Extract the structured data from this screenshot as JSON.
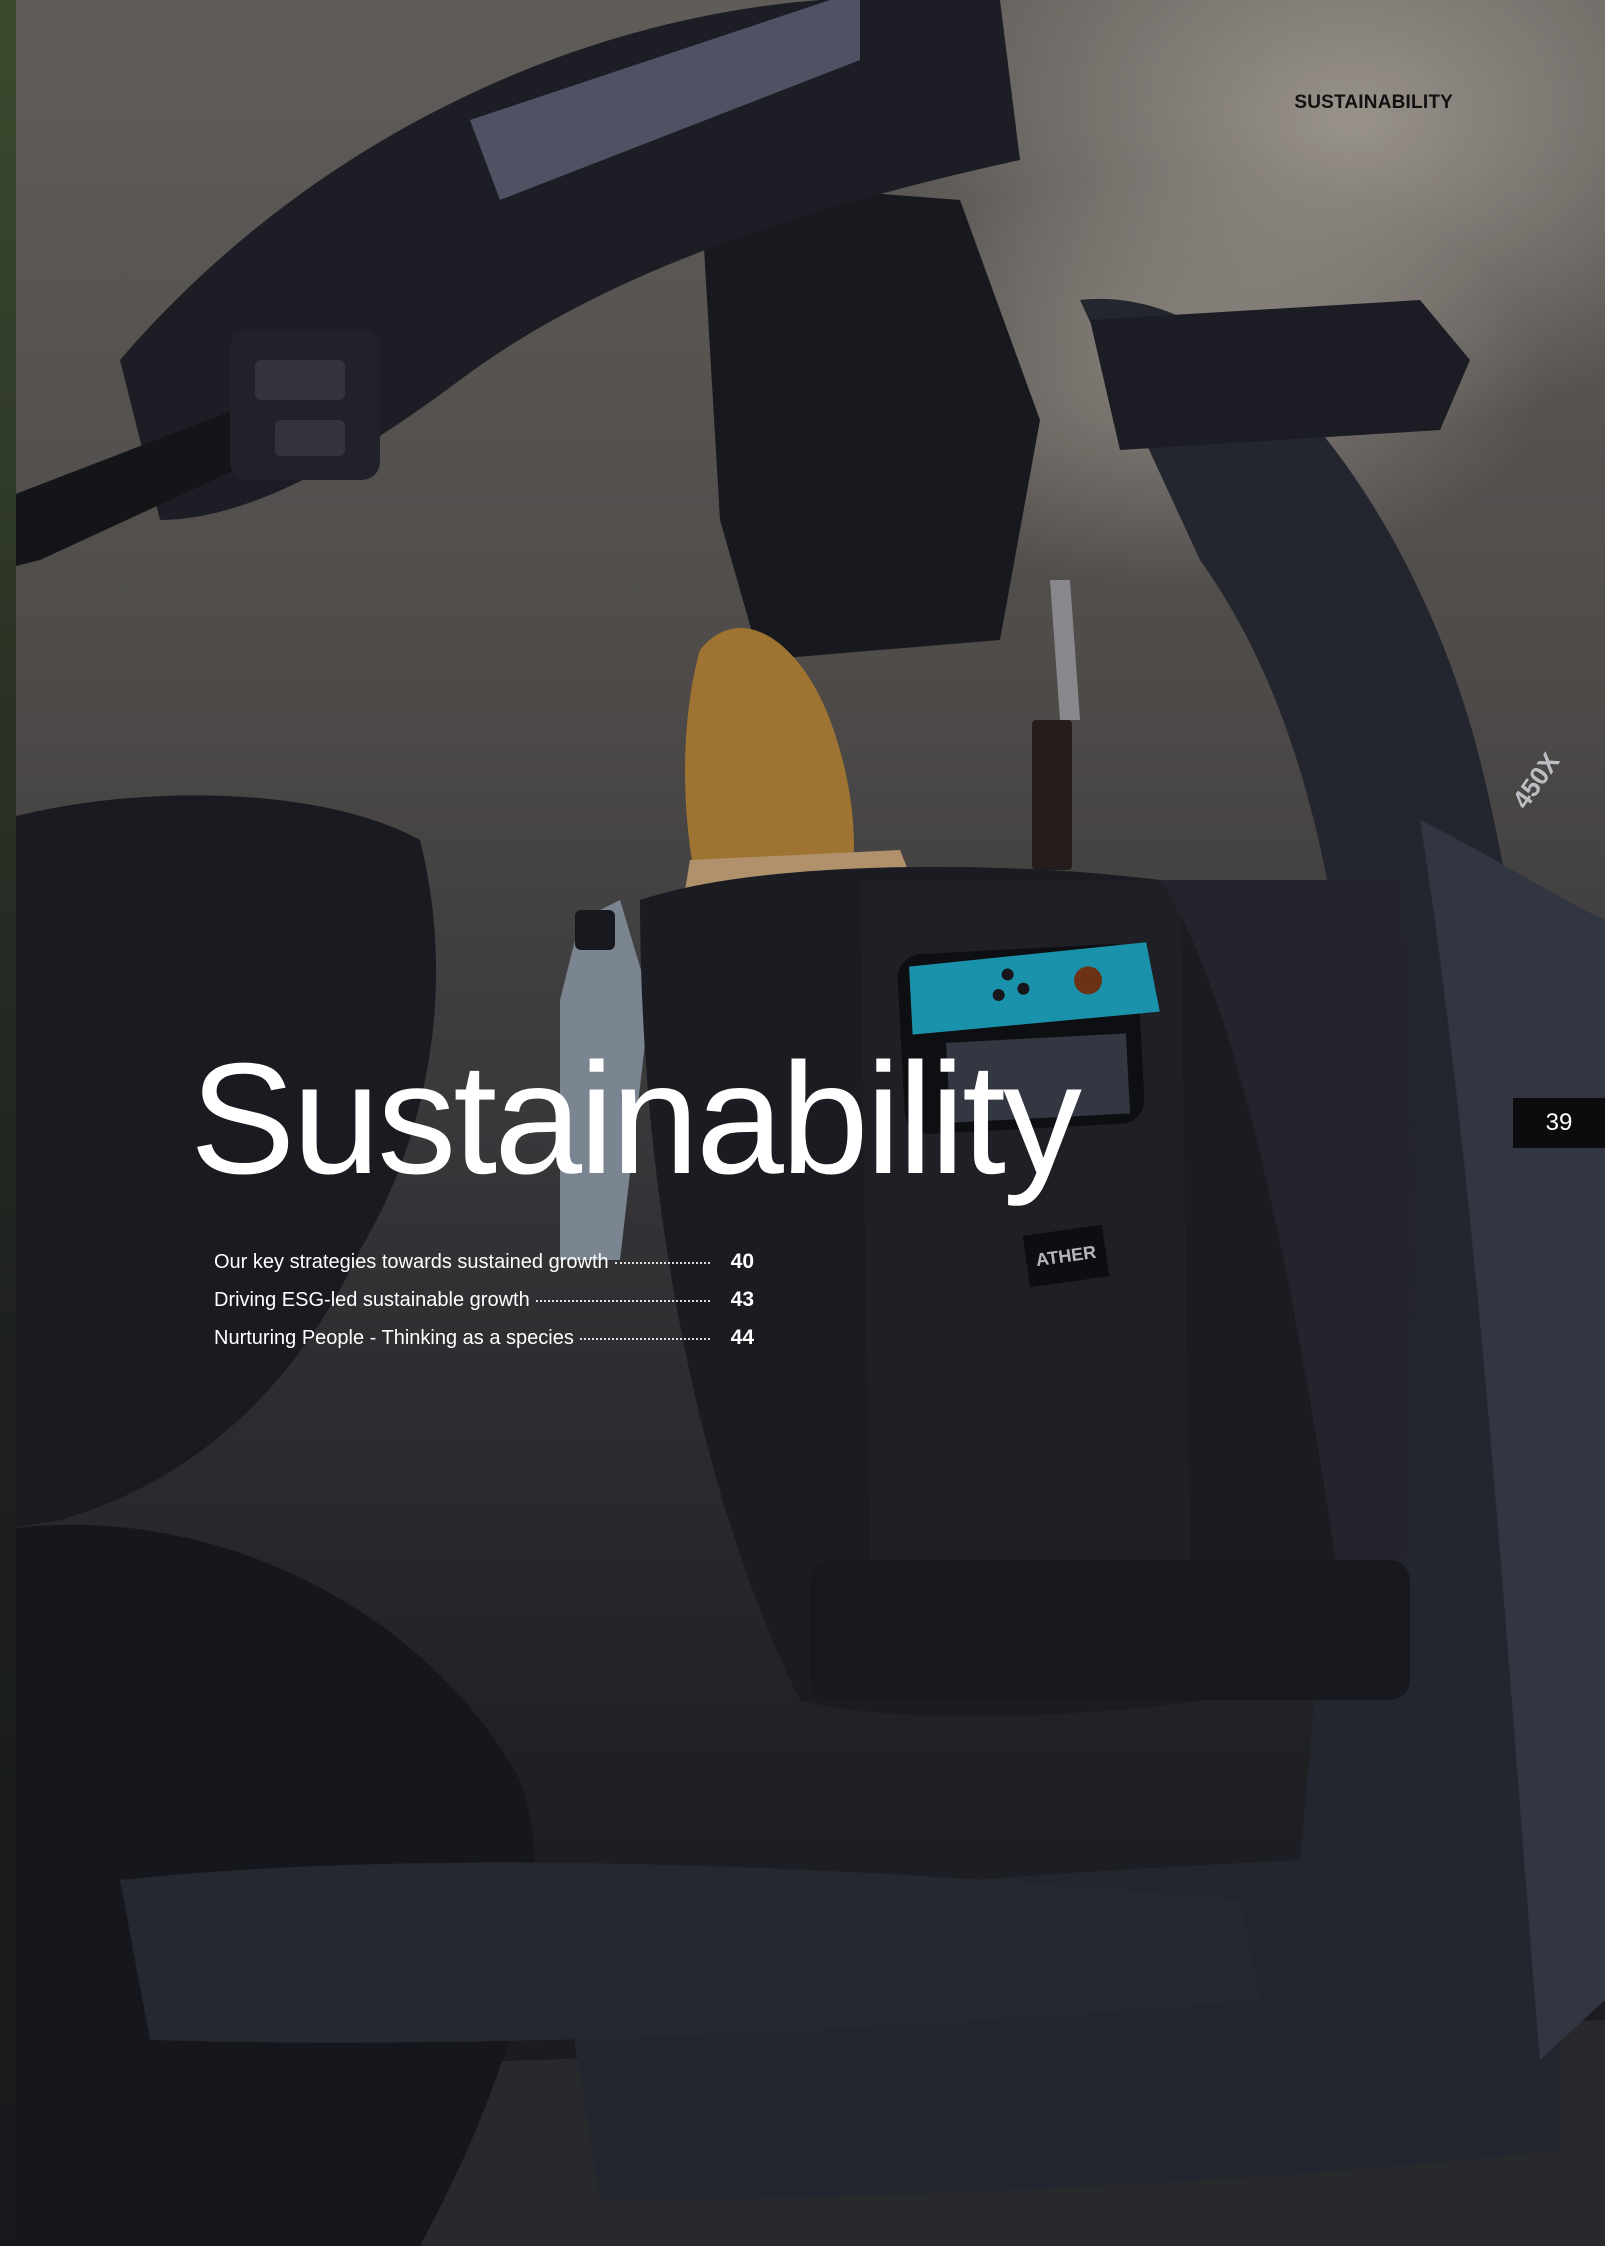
{
  "header": {
    "section_label": "SUSTAINABILITY"
  },
  "page_number": "39",
  "title": "Sustainability",
  "toc": [
    {
      "title": "Our key strategies towards sustained growth",
      "page": "40"
    },
    {
      "title": "Driving ESG-led sustainable growth",
      "page": "43"
    },
    {
      "title": "Nurturing People - Thinking as a species",
      "page": "44"
    }
  ],
  "photo": {
    "bag_label": "ATHER",
    "badge_text": "450X"
  }
}
